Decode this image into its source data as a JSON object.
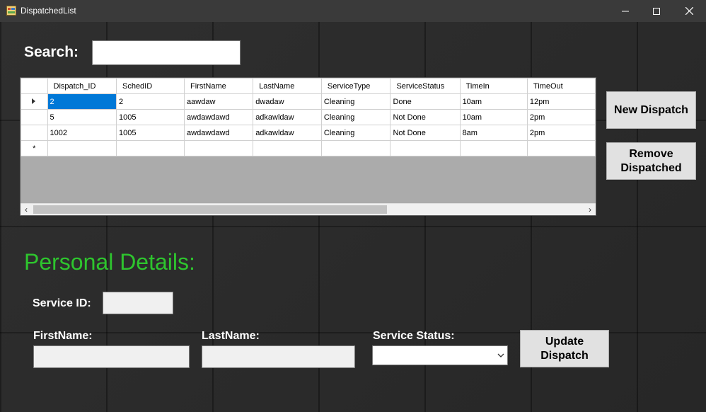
{
  "window": {
    "title": "DispatchedList"
  },
  "search": {
    "label": "Search:",
    "value": ""
  },
  "grid": {
    "columns": [
      "Dispatch_ID",
      "SchedID",
      "FirstName",
      "LastName",
      "ServiceType",
      "ServiceStatus",
      "TimeIn",
      "TimeOut"
    ],
    "rows": [
      [
        "2",
        "2",
        "aawdaw",
        "dwadaw",
        "Cleaning",
        "Done",
        "10am",
        "12pm"
      ],
      [
        "5",
        "1005",
        "awdawdawd",
        "adkawldaw",
        "Cleaning",
        "Not Done",
        "10am",
        "2pm"
      ],
      [
        "1002",
        "1005",
        "awdawdawd",
        "adkawldaw",
        "Cleaning",
        "Not Done",
        "8am",
        "2pm"
      ]
    ],
    "new_row_marker": "*",
    "current_row_marker": "▶"
  },
  "buttons": {
    "new_dispatch": "New Dispatch",
    "remove_dispatched_line1": "Remove",
    "remove_dispatched_line2": "Dispatched",
    "update_dispatch_line1": "Update",
    "update_dispatch_line2": "Dispatch"
  },
  "details": {
    "title": "Personal Details:",
    "service_id_label": "Service ID:",
    "firstname_label": "FirstName:",
    "lastname_label": "LastName:",
    "service_status_label": "Service Status:",
    "service_status_value": ""
  },
  "colors": {
    "accent_green": "#2ec52e",
    "selection_blue": "#0078d7"
  }
}
